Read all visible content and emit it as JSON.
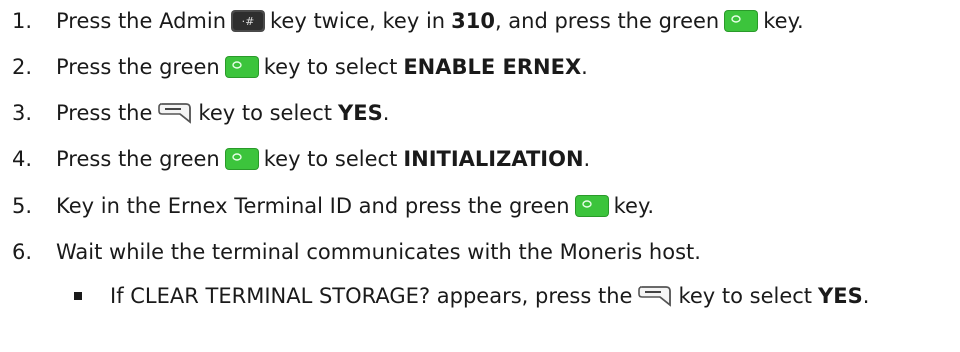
{
  "steps": [
    {
      "number": "1.",
      "parts": [
        "Press the Admin",
        "key twice, key in",
        "310",
        ", and press the green",
        "key."
      ],
      "icons": [
        "admin-hash-key-icon",
        "green-ok-key-icon"
      ]
    },
    {
      "number": "2.",
      "parts": [
        "Press the green",
        "key to select",
        "ENABLE ERNEX",
        "."
      ],
      "icons": [
        "green-ok-key-icon"
      ]
    },
    {
      "number": "3.",
      "parts": [
        "Press the",
        "key to select",
        "YES",
        "."
      ],
      "icons": [
        "softkey-minus-icon"
      ]
    },
    {
      "number": "4.",
      "parts": [
        "Press the green",
        "key to select",
        "INITIALIZATION",
        "."
      ],
      "icons": [
        "green-ok-key-icon"
      ]
    },
    {
      "number": "5.",
      "parts": [
        "Key in the Ernex Terminal ID and press the green",
        "key."
      ],
      "icons": [
        "green-ok-key-icon"
      ]
    },
    {
      "number": "6.",
      "parts": [
        "Wait while the terminal communicates with the Moneris host."
      ],
      "icons": []
    }
  ],
  "sub_bullet": {
    "parts": [
      "If CLEAR TERMINAL STORAGE? appears, press the",
      "key to select",
      "YES",
      "."
    ],
    "icons": [
      "softkey-minus-icon"
    ]
  },
  "colors": {
    "text": "#1a1a1a",
    "green_key": "#3cc43c",
    "admin_key": "#3a3a3a"
  }
}
